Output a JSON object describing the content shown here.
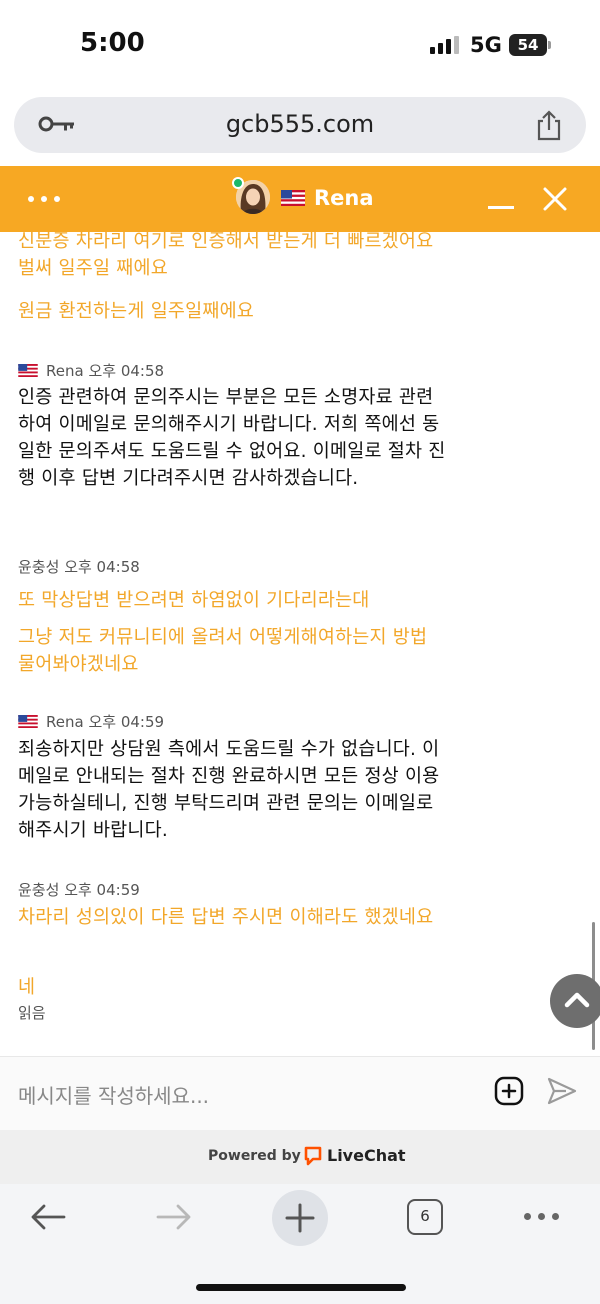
{
  "status_bar": {
    "time": "5:00",
    "network": "5G",
    "battery": "54"
  },
  "browser": {
    "url": "gcb555.com",
    "tab_count": "6"
  },
  "chat_header": {
    "agent_name": "Rena"
  },
  "messages": [
    {
      "role": "user",
      "text": "신분증 차라리 여기로 인증해서 받는게 더 빠르겠어요 벌써 일주일 째에요"
    },
    {
      "role": "user",
      "text": "원금 환전하는게 일주일째에요"
    },
    {
      "role": "agent",
      "sender": "Rena",
      "time": "오후 04:58",
      "text": "인증 관련하여 문의주시는 부분은 모든 소명자료 관련하여 이메일로 문의해주시기 바랍니다. 저희 쪽에선 동일한 문의주셔도 도움드릴 수 없어요. 이메일로 절차 진행 이후 답변 기다려주시면 감사하겠습니다."
    },
    {
      "role": "user",
      "sender": "윤충성",
      "time": "오후 04:58",
      "text": "또 막상답변 받으려면 하염없이 기다리라는대"
    },
    {
      "role": "user",
      "text": "그냥 저도 커뮤니티에 올려서 어떻게해여하는지 방법 물어봐야겠네요"
    },
    {
      "role": "agent",
      "sender": "Rena",
      "time": "오후 04:59",
      "text": "죄송하지만 상담원 측에서 도움드릴 수가 없습니다. 이메일로 안내되는 절차 진행 완료하시면 모든 정상 이용 가능하실테니, 진행 부탁드리며 관련 문의는 이메일로 해주시기 바랍니다."
    },
    {
      "role": "user",
      "sender": "윤충성",
      "time": "오후 04:59",
      "text": "차라리 성의있이 다른 답변 주시면 이해라도 했겠네요"
    },
    {
      "role": "user",
      "text": "네"
    }
  ],
  "read_receipt": "읽음",
  "composer": {
    "placeholder": "메시지를 작성하세요..."
  },
  "footer": {
    "powered_by": "Powered by",
    "brand": "LiveChat"
  },
  "colors": {
    "brand_orange": "#f7a823",
    "user_text": "#f2a72a",
    "agent_text": "#111111"
  },
  "icons": [
    "key-icon",
    "share-icon",
    "more-dots-icon",
    "minimize-icon",
    "close-icon",
    "us-flag-icon",
    "chevron-up-icon",
    "attach-icon",
    "send-icon",
    "livechat-logo-icon",
    "back-arrow-icon",
    "forward-arrow-icon",
    "plus-icon",
    "tabs-icon"
  ]
}
